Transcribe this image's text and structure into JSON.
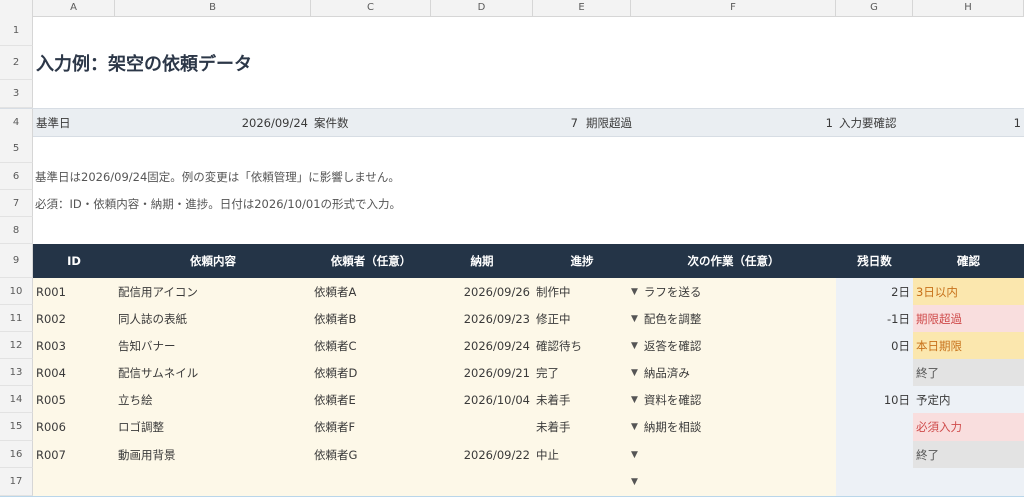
{
  "columns": [
    "A",
    "B",
    "C",
    "D",
    "E",
    "F",
    "G",
    "H"
  ],
  "row_numbers": [
    "1",
    "2",
    "3",
    "4",
    "5",
    "6",
    "7",
    "8",
    "9",
    "10",
    "11",
    "12",
    "13",
    "14",
    "15",
    "16",
    "17"
  ],
  "title": "入力例：架空の依頼データ",
  "summary": {
    "base_label": "基準日",
    "base_date": "2026/09/24",
    "count_label": "案件数",
    "count": "7",
    "overdue_label": "期限超過",
    "overdue": "1",
    "needs_label": "入力要確認",
    "needs": "1"
  },
  "notes": {
    "line1": "基準日は2026/09/24固定。例の変更は「依頼管理」に影響しません。",
    "line2": "必須：ID・依頼内容・納期・進捗。日付は2026/10/01の形式で入力。"
  },
  "table": {
    "headers": [
      "ID",
      "依頼内容",
      "依頼者（任意）",
      "納期",
      "進捗",
      "次の作業（任意）",
      "残日数",
      "確認"
    ],
    "rows": [
      {
        "id": "R001",
        "content": "配信用アイコン",
        "requester": "依頼者A",
        "due": "2026/09/26",
        "status": "制作中",
        "next": "ラフを送る",
        "days": "2日",
        "check": "3日以内",
        "check_style": "yellow"
      },
      {
        "id": "R002",
        "content": "同人誌の表紙",
        "requester": "依頼者B",
        "due": "2026/09/23",
        "status": "修正中",
        "next": "配色を調整",
        "days": "-1日",
        "check": "期限超過",
        "check_style": "red"
      },
      {
        "id": "R003",
        "content": "告知バナー",
        "requester": "依頼者C",
        "due": "2026/09/24",
        "status": "確認待ち",
        "next": "返答を確認",
        "days": "0日",
        "check": "本日期限",
        "check_style": "yellow"
      },
      {
        "id": "R004",
        "content": "配信サムネイル",
        "requester": "依頼者D",
        "due": "2026/09/21",
        "status": "完了",
        "next": "納品済み",
        "days": "",
        "check": "終了",
        "check_style": "grey"
      },
      {
        "id": "R005",
        "content": "立ち絵",
        "requester": "依頼者E",
        "due": "2026/10/04",
        "status": "未着手",
        "next": "資料を確認",
        "days": "10日",
        "check": "予定内",
        "check_style": "plain"
      },
      {
        "id": "R006",
        "content": "ロゴ調整",
        "requester": "依頼者F",
        "due": "",
        "status": "未着手",
        "next": "納期を相談",
        "days": "",
        "check": "必須入力",
        "check_style": "red"
      },
      {
        "id": "R007",
        "content": "動画用背景",
        "requester": "依頼者G",
        "due": "2026/09/22",
        "status": "中止",
        "next": "",
        "days": "",
        "check": "終了",
        "check_style": "grey"
      },
      {
        "id": "",
        "content": "",
        "requester": "",
        "due": "",
        "status": "",
        "next": "",
        "days": "",
        "check": "",
        "check_style": "plain"
      }
    ]
  },
  "icons": {
    "dropdown": "dropdown-arrow-icon"
  },
  "colors": {
    "header_bg": "#243447",
    "cream": "#fdf8e8",
    "blue": "#edf1f6",
    "yellow": "#fbe7ae",
    "red": "#f9dede",
    "grey": "#e3e3e3"
  }
}
